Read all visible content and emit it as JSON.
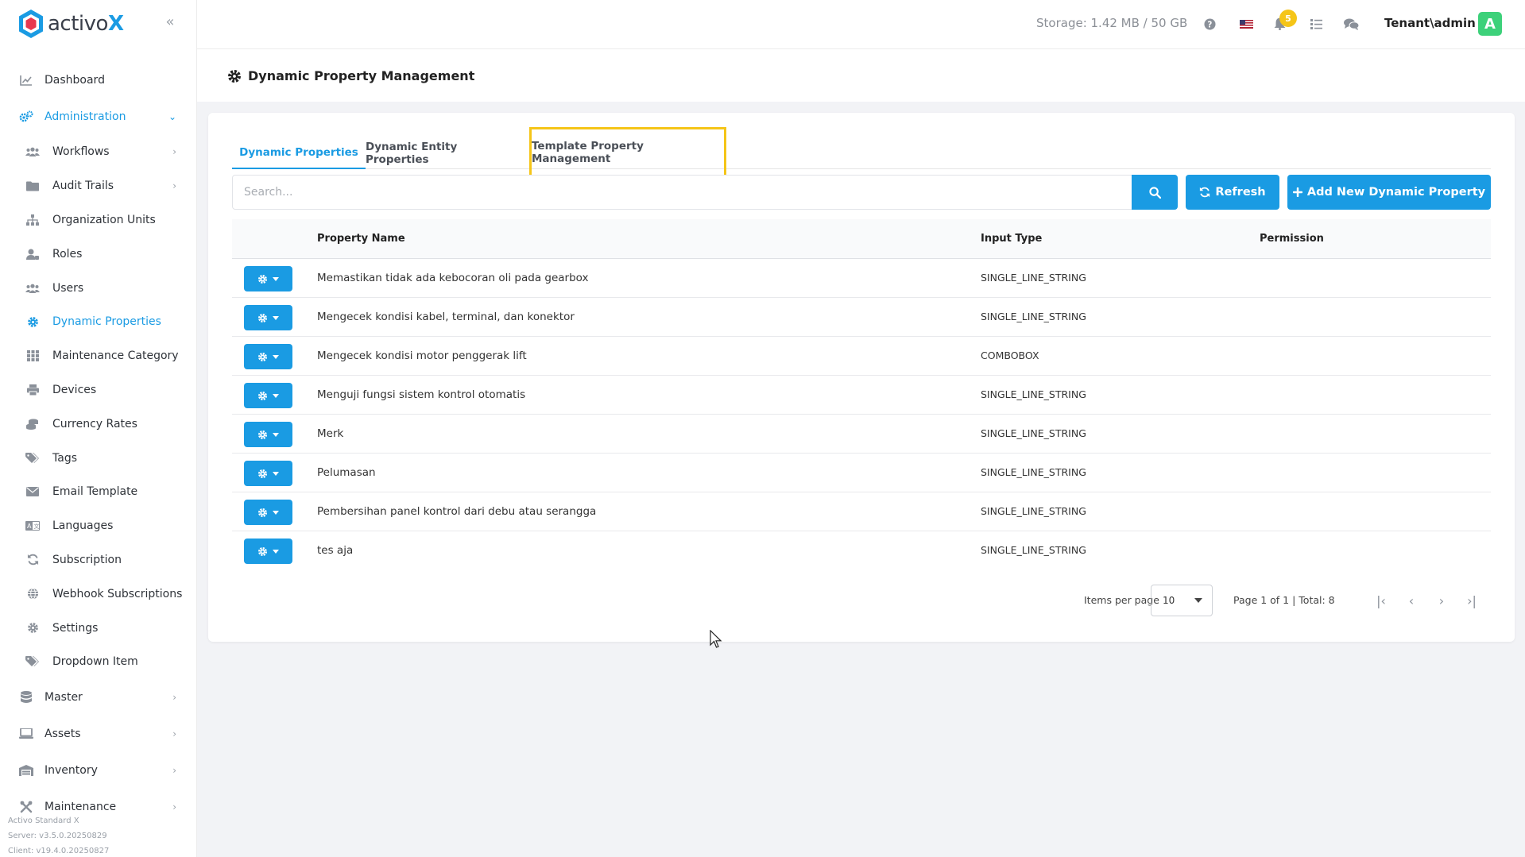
{
  "brand": {
    "name_part1": "activo",
    "name_part2": "X"
  },
  "sidebar": {
    "top_items": [
      {
        "label": "Dashboard",
        "icon": "chart-line-icon"
      },
      {
        "label": "Administration",
        "icon": "gears-icon",
        "expanded": true
      }
    ],
    "admin_items": [
      {
        "label": "Workflows",
        "icon": "users-icon",
        "has_children": true
      },
      {
        "label": "Audit Trails",
        "icon": "folder-icon",
        "has_children": true
      },
      {
        "label": "Organization Units",
        "icon": "sitemap-icon"
      },
      {
        "label": "Roles",
        "icon": "user-tag-icon"
      },
      {
        "label": "Users",
        "icon": "users-icon"
      },
      {
        "label": "Dynamic Properties",
        "icon": "gear-icon",
        "active": true
      },
      {
        "label": "Maintenance Category",
        "icon": "grid-icon"
      },
      {
        "label": "Devices",
        "icon": "printer-icon"
      },
      {
        "label": "Currency Rates",
        "icon": "coins-icon"
      },
      {
        "label": "Tags",
        "icon": "tags-icon"
      },
      {
        "label": "Email Template",
        "icon": "envelope-icon"
      },
      {
        "label": "Languages",
        "icon": "language-icon"
      },
      {
        "label": "Subscription",
        "icon": "refresh-icon"
      },
      {
        "label": "Webhook Subscriptions",
        "icon": "globe-icon"
      },
      {
        "label": "Settings",
        "icon": "gear-icon"
      },
      {
        "label": "Dropdown Item",
        "icon": "tags-icon"
      }
    ],
    "bottom_items": [
      {
        "label": "Master",
        "icon": "database-icon"
      },
      {
        "label": "Assets",
        "icon": "laptop-icon"
      },
      {
        "label": "Inventory",
        "icon": "warehouse-icon"
      },
      {
        "label": "Maintenance",
        "icon": "tools-icon"
      }
    ],
    "version": {
      "product": "Activo Standard X",
      "server": "Server: v3.5.0.20250829",
      "client": "Client: v19.4.0.20250827"
    }
  },
  "topbar": {
    "storage": "Storage: 1.42 MB / 50 GB",
    "notifications_count": "5",
    "user": "Tenant\\admin",
    "avatar_letter": "A"
  },
  "page": {
    "title": "Dynamic Property Management",
    "tabs": [
      {
        "label": "Dynamic Properties",
        "active": true
      },
      {
        "label": "Dynamic Entity Properties"
      },
      {
        "label": "Template Property Management",
        "highlighted": true
      }
    ],
    "search_placeholder": "Search...",
    "refresh_label": "Refresh",
    "add_label": "Add New Dynamic Property"
  },
  "table": {
    "columns": [
      "Property Name",
      "Input Type",
      "Permission"
    ],
    "rows": [
      {
        "name": "Memastikan tidak ada kebocoran oli pada gearbox",
        "type": "SINGLE_LINE_STRING",
        "permission": ""
      },
      {
        "name": "Mengecek kondisi kabel, terminal, dan konektor",
        "type": "SINGLE_LINE_STRING",
        "permission": ""
      },
      {
        "name": "Mengecek kondisi motor penggerak lift",
        "type": "COMBOBOX",
        "permission": ""
      },
      {
        "name": "Menguji fungsi sistem kontrol otomatis",
        "type": "SINGLE_LINE_STRING",
        "permission": ""
      },
      {
        "name": "Merk",
        "type": "SINGLE_LINE_STRING",
        "permission": ""
      },
      {
        "name": "Pelumasan",
        "type": "SINGLE_LINE_STRING",
        "permission": ""
      },
      {
        "name": "Pembersihan panel kontrol dari debu atau serangga",
        "type": "SINGLE_LINE_STRING",
        "permission": ""
      },
      {
        "name": "tes aja",
        "type": "SINGLE_LINE_STRING",
        "permission": ""
      }
    ]
  },
  "pagination": {
    "items_per_page_label": "Items per page",
    "items_per_page": "10",
    "info": "Page 1 of 1 | Total: 8"
  },
  "colors": {
    "accent": "#1a9be3",
    "highlight": "#f5c518",
    "avatar": "#3dd17a"
  }
}
